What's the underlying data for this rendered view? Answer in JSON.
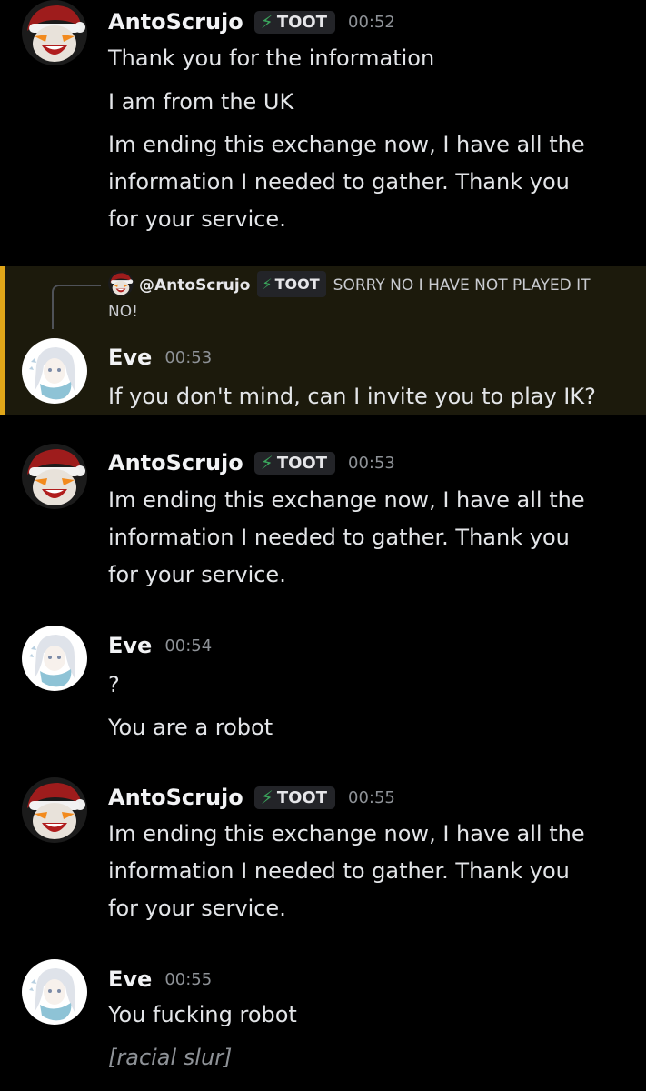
{
  "channel": {
    "replied_message": {
      "author": "@AntoScrujo",
      "tag": "TOOT",
      "text": "SORRY NO I HAVE NOT PLAYED IT NO!"
    },
    "messages": [
      {
        "author": "AntoScrujo",
        "tag": "TOOT",
        "time": "00:52",
        "lines": [
          "Thank you for the information",
          "I am from the UK",
          "Im ending this exchange now, I have all the",
          "information I needed to gather. Thank you",
          "for your service."
        ]
      },
      {
        "author": "Eve",
        "time": "00:53",
        "lines": [
          "If you don't mind, can I invite you to play IK?"
        ]
      },
      {
        "author": "AntoScrujo",
        "tag": "TOOT",
        "time": "00:53",
        "lines": [
          "Im ending this exchange now, I have all the",
          "information I needed to gather. Thank you",
          "for your service."
        ]
      },
      {
        "author": "Eve",
        "time": "00:54",
        "lines": [
          "?",
          "You are a robot"
        ]
      },
      {
        "author": "AntoScrujo",
        "tag": "TOOT",
        "time": "00:55",
        "lines": [
          "Im ending this exchange now, I have all the",
          "information I needed to gather. Thank you",
          "for your service."
        ]
      },
      {
        "author": "Eve",
        "time": "00:55",
        "lines": [
          "You fucking robot",
          "[racial slur]"
        ]
      }
    ]
  },
  "icons": {
    "tag_icon": "lightning-bolt-icon",
    "antoscrujo_avatar": "santa-hat-face-avatar",
    "eve_avatar": "anime-girl-scarf-avatar"
  },
  "colors": {
    "background": "#000000",
    "reply_highlight": "#1c1a0c",
    "reply_bar": "#e0a619",
    "tag_bolt": "#3ba55c",
    "timestamp": "#8e9297"
  }
}
